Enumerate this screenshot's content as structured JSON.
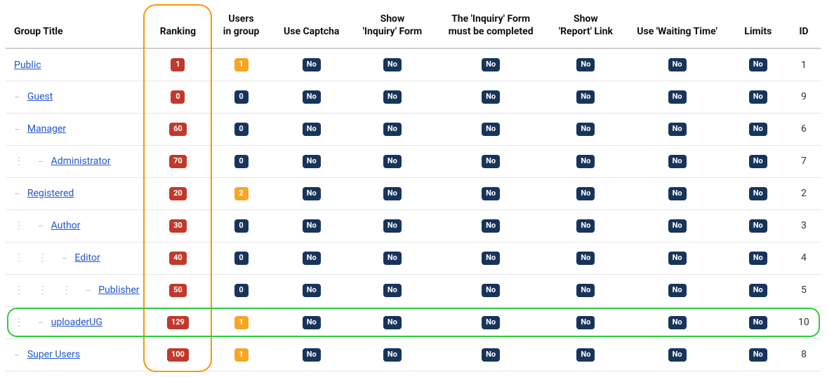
{
  "columns": {
    "group_title": "Group Title",
    "ranking": "Ranking",
    "users_in_group": "Users\nin group",
    "use_captcha": "Use Captcha",
    "show_inquiry": "Show\n'Inquiry' Form",
    "inquiry_must": "The 'Inquiry' Form\nmust be completed",
    "show_report": "Show\n'Report' Link",
    "use_waiting": "Use 'Waiting Time'",
    "limits": "Limits",
    "id": "ID"
  },
  "badge_colors": {
    "ranking": "#c0392b",
    "users_zero": "#18345b",
    "users_nonzero": "#f5a623",
    "no": "#18345b"
  },
  "no_label": "No",
  "rows": [
    {
      "indent": 0,
      "title": "Public",
      "ranking": "1",
      "users": "1",
      "use_captcha": "No",
      "show_inquiry": "No",
      "inquiry_must": "No",
      "show_report": "No",
      "use_waiting": "No",
      "limits": "No",
      "id": "1"
    },
    {
      "indent": 1,
      "title": "Guest",
      "ranking": "0",
      "users": "0",
      "use_captcha": "No",
      "show_inquiry": "No",
      "inquiry_must": "No",
      "show_report": "No",
      "use_waiting": "No",
      "limits": "No",
      "id": "9"
    },
    {
      "indent": 1,
      "title": "Manager",
      "ranking": "60",
      "users": "0",
      "use_captcha": "No",
      "show_inquiry": "No",
      "inquiry_must": "No",
      "show_report": "No",
      "use_waiting": "No",
      "limits": "No",
      "id": "6"
    },
    {
      "indent": 2,
      "title": "Administrator",
      "ranking": "70",
      "users": "0",
      "use_captcha": "No",
      "show_inquiry": "No",
      "inquiry_must": "No",
      "show_report": "No",
      "use_waiting": "No",
      "limits": "No",
      "id": "7"
    },
    {
      "indent": 1,
      "title": "Registered",
      "ranking": "20",
      "users": "2",
      "use_captcha": "No",
      "show_inquiry": "No",
      "inquiry_must": "No",
      "show_report": "No",
      "use_waiting": "No",
      "limits": "No",
      "id": "2"
    },
    {
      "indent": 2,
      "title": "Author",
      "ranking": "30",
      "users": "0",
      "use_captcha": "No",
      "show_inquiry": "No",
      "inquiry_must": "No",
      "show_report": "No",
      "use_waiting": "No",
      "limits": "No",
      "id": "3"
    },
    {
      "indent": 3,
      "title": "Editor",
      "ranking": "40",
      "users": "0",
      "use_captcha": "No",
      "show_inquiry": "No",
      "inquiry_must": "No",
      "show_report": "No",
      "use_waiting": "No",
      "limits": "No",
      "id": "4"
    },
    {
      "indent": 4,
      "title": "Publisher",
      "ranking": "50",
      "users": "0",
      "use_captcha": "No",
      "show_inquiry": "No",
      "inquiry_must": "No",
      "show_report": "No",
      "use_waiting": "No",
      "limits": "No",
      "id": "5"
    },
    {
      "indent": 2,
      "title": "uploaderUG",
      "ranking": "129",
      "users": "1",
      "use_captcha": "No",
      "show_inquiry": "No",
      "inquiry_must": "No",
      "show_report": "No",
      "use_waiting": "No",
      "limits": "No",
      "id": "10",
      "highlight": "green"
    },
    {
      "indent": 1,
      "title": "Super Users",
      "ranking": "100",
      "users": "1",
      "use_captcha": "No",
      "show_inquiry": "No",
      "inquiry_must": "No",
      "show_report": "No",
      "use_waiting": "No",
      "limits": "No",
      "id": "8"
    }
  ],
  "highlights": {
    "ranking_column": true,
    "uploaderUG_row": true
  }
}
